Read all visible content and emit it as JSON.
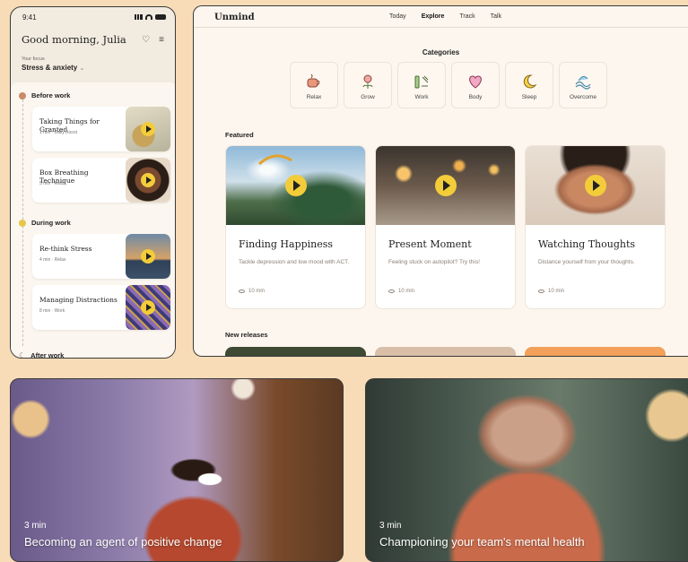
{
  "phone": {
    "status_time": "9:41",
    "greeting": "Good morning, Julia",
    "focus_label": "Your focus",
    "focus_value": "Stress & anxiety",
    "sections": [
      {
        "label": "Before work",
        "color": "#c98a6b"
      },
      {
        "label": "During work",
        "color": "#e6c64e"
      },
      {
        "label": "After work",
        "color": "#8a8a8a"
      }
    ],
    "tasks": [
      {
        "title": "Taking Things for Granted",
        "meta": "1 min · Daily Boost"
      },
      {
        "title": "Box Breathing Technique",
        "meta": "5 min · Relax"
      },
      {
        "title": "Re-think Stress",
        "meta": "4 min · Relax"
      },
      {
        "title": "Managing Distractions",
        "meta": "8 min · Work"
      }
    ]
  },
  "web": {
    "brand": "Unmind",
    "tabs": [
      "Today",
      "Explore",
      "Track",
      "Talk"
    ],
    "active_tab": "Explore",
    "categories_heading": "Categories",
    "categories": [
      {
        "label": "Relax",
        "icon": "cup-icon"
      },
      {
        "label": "Grow",
        "icon": "flower-icon"
      },
      {
        "label": "Work",
        "icon": "tools-icon"
      },
      {
        "label": "Body",
        "icon": "heart-icon"
      },
      {
        "label": "Sleep",
        "icon": "moon-icon"
      },
      {
        "label": "Overcome",
        "icon": "waves-icon"
      }
    ],
    "featured_heading": "Featured",
    "featured": [
      {
        "title": "Finding Happiness",
        "desc": "Tackle depression and low mood with ACT.",
        "time": "10 min"
      },
      {
        "title": "Present Moment",
        "desc": "Feeling stuck on autopilot? Try this!",
        "time": "10 min"
      },
      {
        "title": "Watching Thoughts",
        "desc": "Distance yourself from your thoughts.",
        "time": "10 min"
      }
    ],
    "new_releases_heading": "New releases"
  },
  "videos": [
    {
      "duration": "3 min",
      "title": "Becoming an agent of positive change"
    },
    {
      "duration": "3 min",
      "title": "Championing your team's mental health"
    }
  ],
  "colors": {
    "page_bg": "#f8dcb7",
    "accent_yellow": "#f3cc3a",
    "card_bg": "#fdf6ee"
  }
}
